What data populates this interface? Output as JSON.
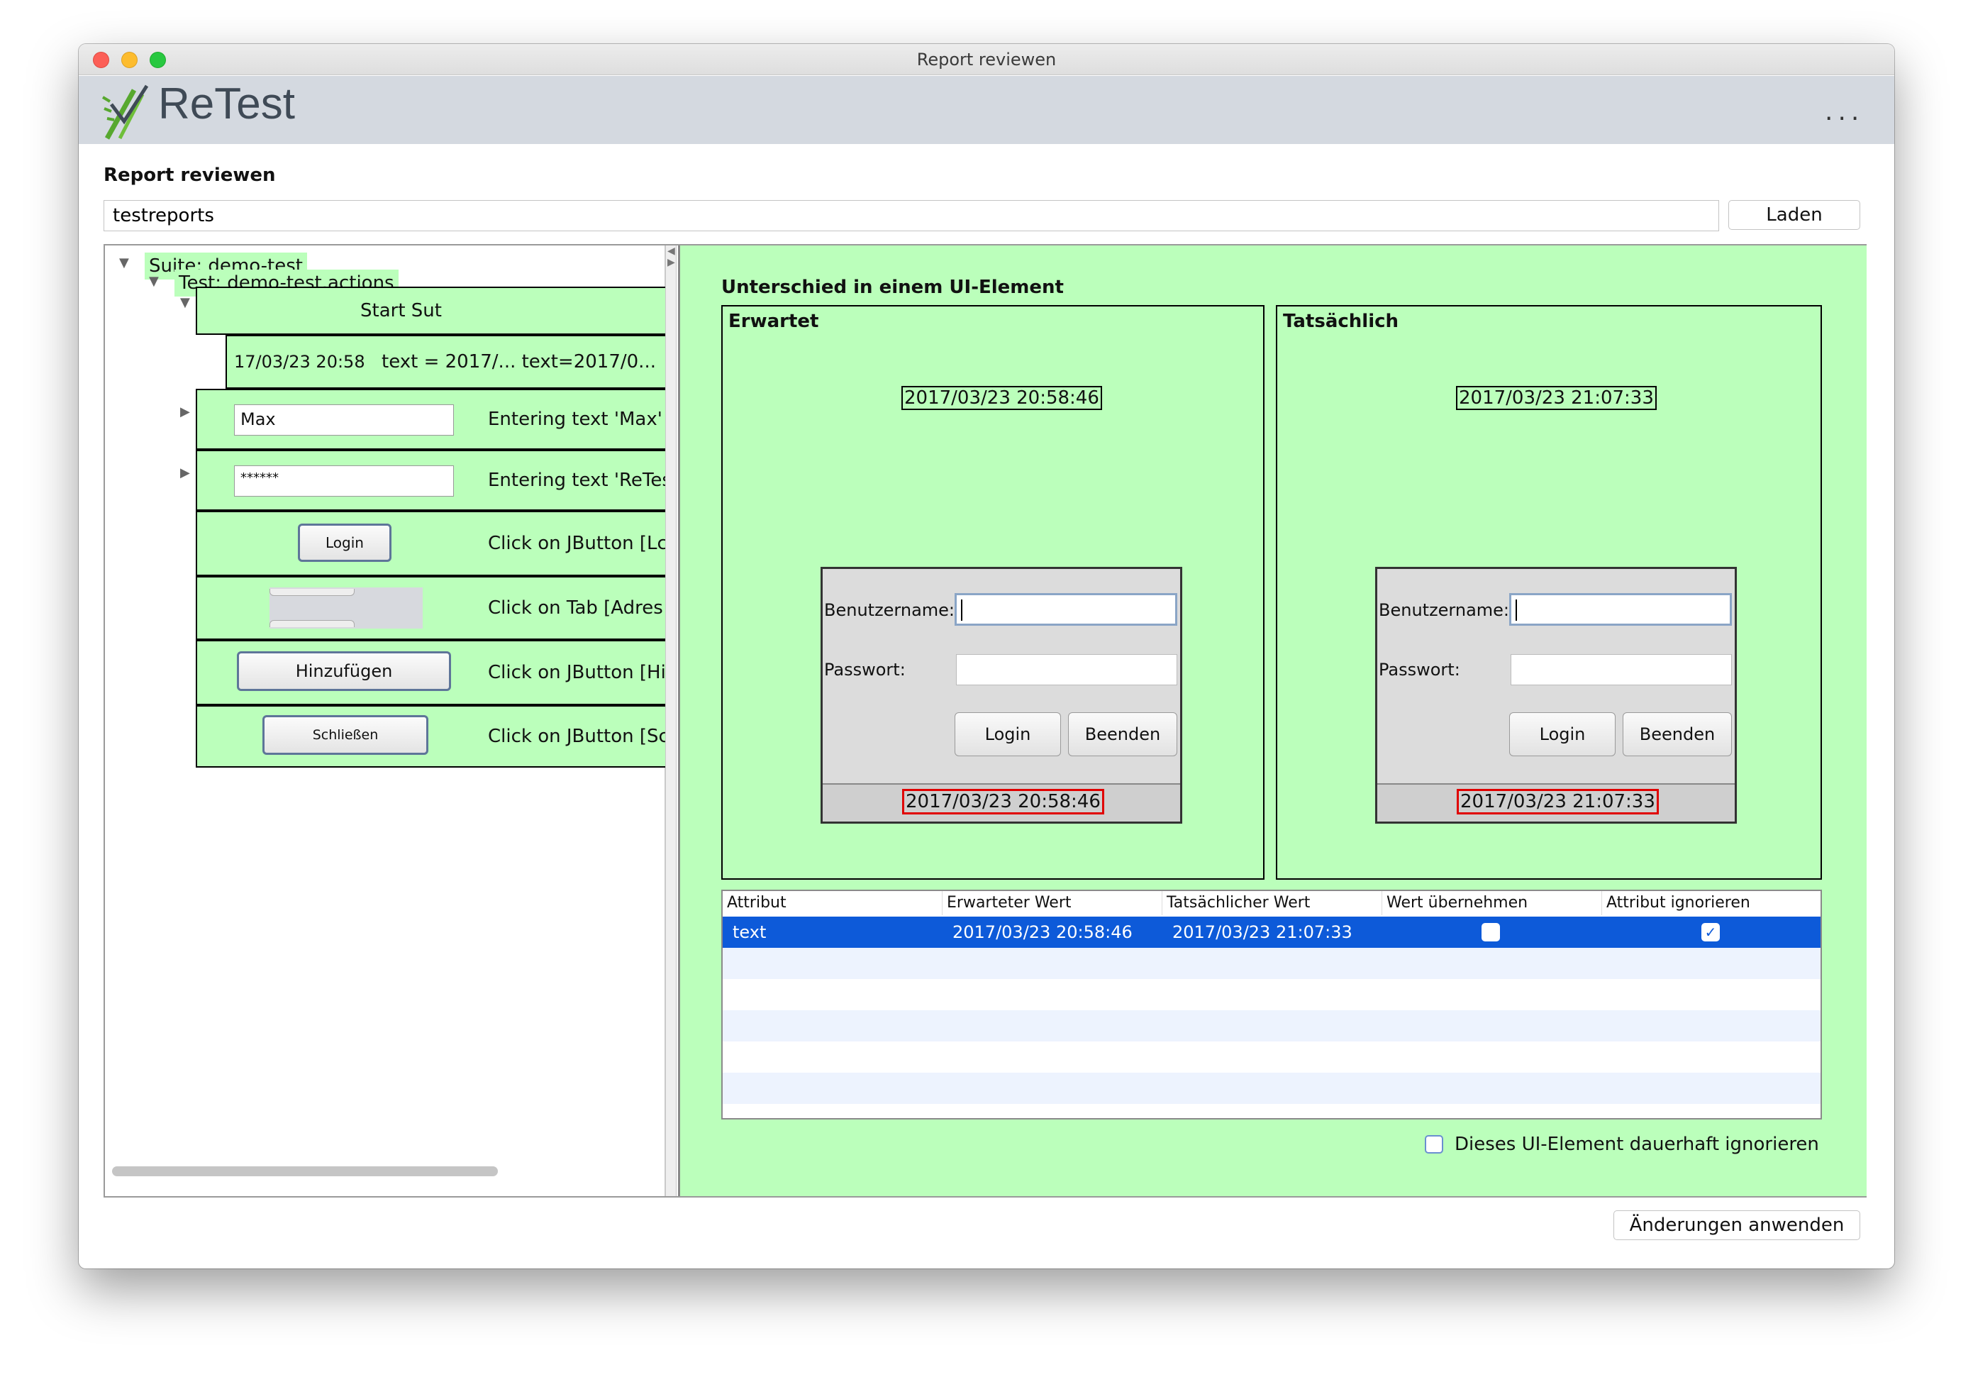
{
  "window": {
    "title": "Report reviewen"
  },
  "header": {
    "logo_text": "ReTest",
    "more_label": "..."
  },
  "page": {
    "heading": "Report reviewen",
    "path_value": "testreports",
    "load_label": "Laden",
    "apply_label": "Änderungen anwenden"
  },
  "tree": {
    "suite_label": "Suite: demo-test",
    "test_label": "Test: demo-test.actions",
    "steps": [
      {
        "label": "Start Sut"
      },
      {
        "preview": "17/03/23 20:58",
        "label": "text = 2017/...  text=2017/0..."
      },
      {
        "preview": "Max",
        "label": "Entering text 'Max'"
      },
      {
        "preview": "******",
        "label": "Entering text 'ReTes"
      },
      {
        "preview": "Login",
        "label": "Click on JButton [Lc"
      },
      {
        "preview": "",
        "label": "Click on Tab [Adres"
      },
      {
        "preview": "Hinzufügen",
        "label": "Click on JButton [Hi"
      },
      {
        "preview": "Schließen",
        "label": "Click on JButton [Sc"
      }
    ]
  },
  "diff": {
    "title": "Unterschied in einem UI-Element",
    "expected": {
      "title": "Erwartet",
      "timestamp": "2017/03/23 20:58:46",
      "username_label": "Benutzername:",
      "password_label": "Passwort:",
      "login_label": "Login",
      "exit_label": "Beenden",
      "status_timestamp": "2017/03/23 20:58:46"
    },
    "actual": {
      "title": "Tatsächlich",
      "timestamp": "2017/03/23 21:07:33",
      "username_label": "Benutzername:",
      "password_label": "Passwort:",
      "login_label": "Login",
      "exit_label": "Beenden",
      "status_timestamp": "2017/03/23 21:07:33"
    }
  },
  "table": {
    "headers": [
      "Attribut",
      "Erwarteter Wert",
      "Tatsächlicher Wert",
      "Wert übernehmen",
      "Attribut ignorieren"
    ],
    "rows": [
      {
        "attribute": "text",
        "expected": "2017/03/23 20:58:46",
        "actual": "2017/03/23 21:07:33",
        "accept": false,
        "ignore": true
      }
    ]
  },
  "ignore_element_label": "Dieses UI-Element dauerhaft ignorieren",
  "colors": {
    "diff_green": "#bbffbb",
    "selection_blue": "#0d5ad9",
    "highlight_red": "#e00000"
  }
}
